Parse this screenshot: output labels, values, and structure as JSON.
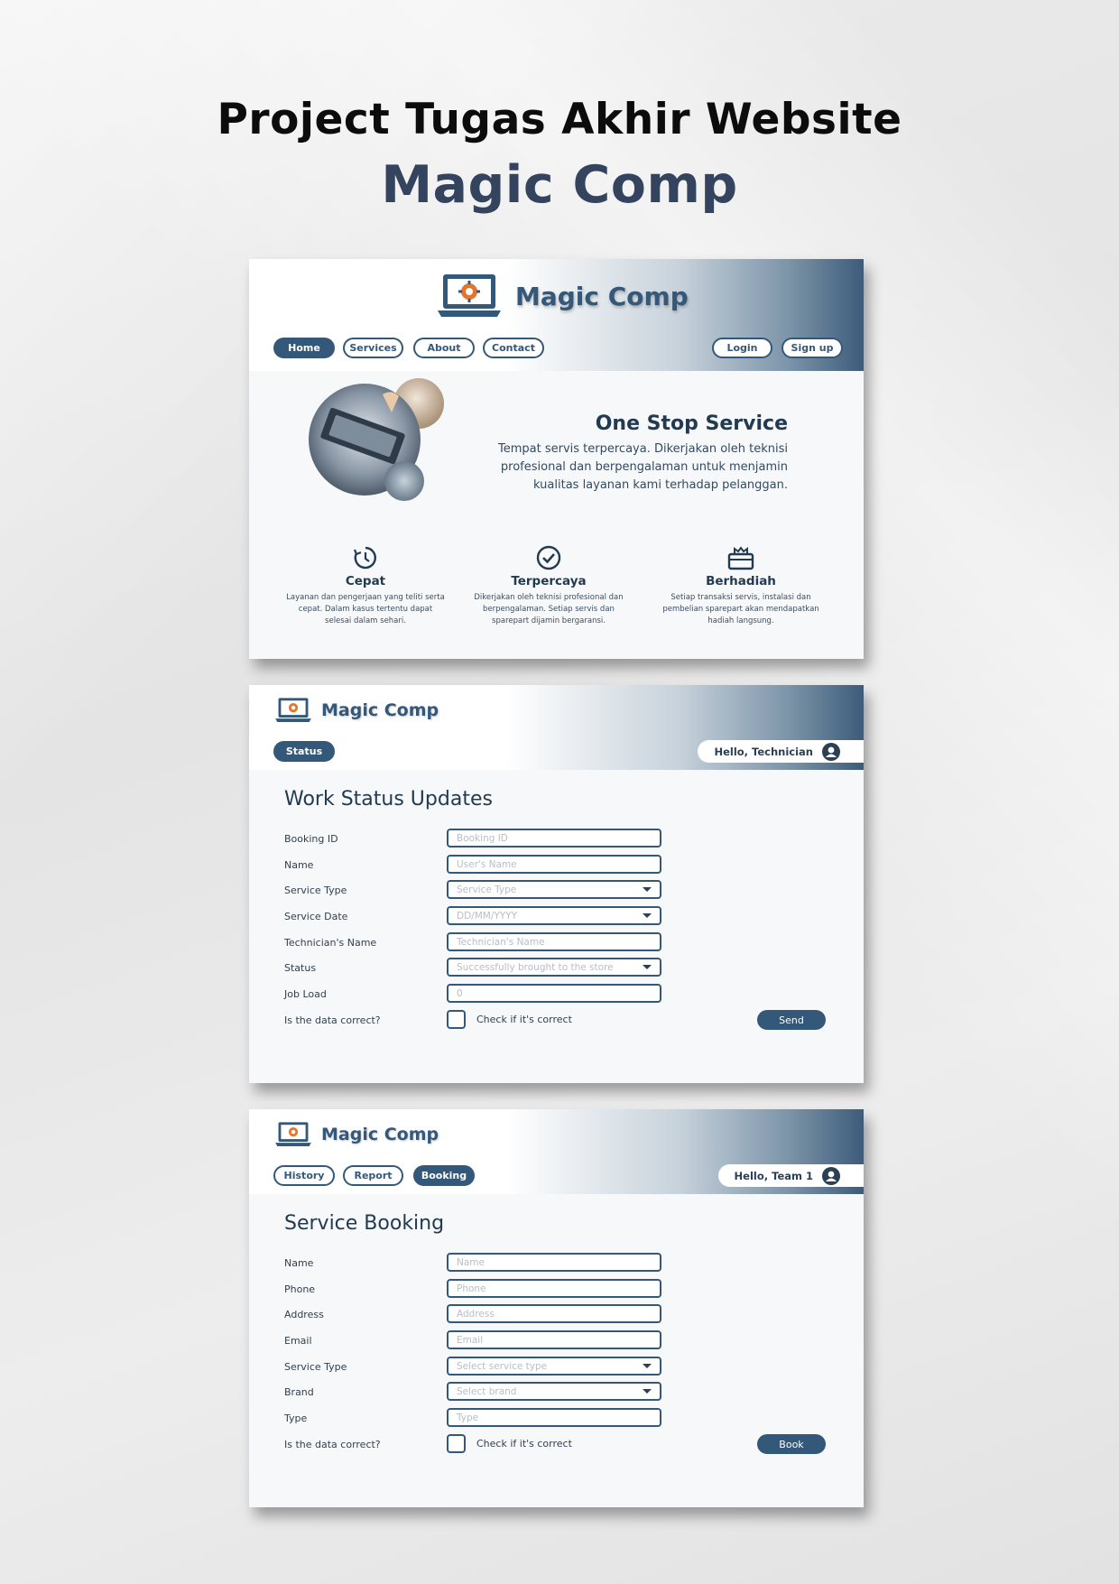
{
  "poster": {
    "title": "Project Tugas Akhir Website",
    "subtitle": "Magic Comp"
  },
  "colors": {
    "primary": "#34587a",
    "dark": "#223a52"
  },
  "landing": {
    "brand": "Magic Comp",
    "nav": [
      "Home",
      "Services",
      "About",
      "Contact"
    ],
    "active_nav": "Home",
    "auth": {
      "login": "Login",
      "signup": "Sign up"
    },
    "hero": {
      "title": "One Stop Service",
      "text": "Tempat servis terpercaya. Dikerjakan oleh teknisi profesional dan berpengalaman untuk menjamin kualitas layanan kami terhadap pelanggan."
    },
    "features": [
      {
        "icon": "clock-icon",
        "title": "Cepat",
        "text": "Layanan dan pengerjaan yang teliti serta cepat. Dalam kasus tertentu dapat selesai dalam sehari."
      },
      {
        "icon": "check-circle-icon",
        "title": "Terpercaya",
        "text": "Dikerjakan oleh teknisi profesional dan berpengalaman. Setiap servis dan sparepart dijamin bergaransi."
      },
      {
        "icon": "gift-icon",
        "title": "Berhadiah",
        "text": "Setiap transaksi servis, instalasi dan pembelian sparepart akan mendapatkan hadiah langsung."
      }
    ]
  },
  "status_page": {
    "brand": "Magic Comp",
    "tab": "Status",
    "greeting": "Hello, Technician",
    "title": "Work Status Updates",
    "fields": [
      {
        "label": "Booking ID",
        "placeholder": "Booking ID"
      },
      {
        "label": "Name",
        "placeholder": "User's Name"
      },
      {
        "label": "Service Type",
        "placeholder": "Service Type"
      },
      {
        "label": "Service Date",
        "placeholder": "DD/MM/YYYY"
      },
      {
        "label": "Technician's Name",
        "placeholder": "Technician's Name"
      },
      {
        "label": "Status",
        "placeholder": "Successfully brought to the store"
      },
      {
        "label": "Job Load",
        "placeholder": "0"
      }
    ],
    "confirm_label": "Is the data correct?",
    "check_label": "Check if it's correct",
    "submit": "Send"
  },
  "booking_page": {
    "brand": "Magic Comp",
    "tabs": [
      "History",
      "Report",
      "Booking"
    ],
    "active_tab": "Booking",
    "greeting": "Hello, Team 1",
    "title": "Service Booking",
    "fields": [
      {
        "label": "Name",
        "placeholder": "Name"
      },
      {
        "label": "Phone",
        "placeholder": "Phone"
      },
      {
        "label": "Address",
        "placeholder": "Address"
      },
      {
        "label": "Email",
        "placeholder": "Email"
      },
      {
        "label": "Service Type",
        "placeholder": "Select service type"
      },
      {
        "label": "Brand",
        "placeholder": "Select brand"
      },
      {
        "label": "Type",
        "placeholder": "Type"
      }
    ],
    "confirm_label": "Is the data correct?",
    "check_label": "Check if it's correct",
    "submit": "Book"
  }
}
